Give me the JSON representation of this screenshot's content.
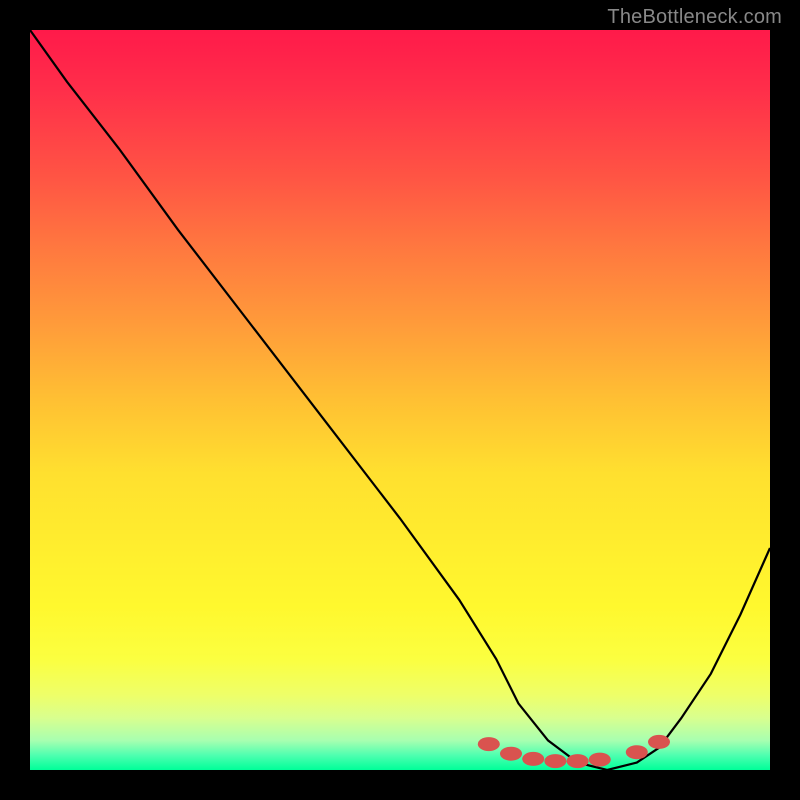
{
  "watermark": "TheBottleneck.com",
  "chart_data": {
    "type": "line",
    "title": "",
    "xlabel": "",
    "ylabel": "",
    "xlim": [
      0,
      100
    ],
    "ylim": [
      0,
      100
    ],
    "series": [
      {
        "name": "bottleneck-curve",
        "x": [
          0,
          5,
          12,
          20,
          30,
          40,
          50,
          58,
          63,
          66,
          70,
          74,
          78,
          82,
          85,
          88,
          92,
          96,
          100
        ],
        "y": [
          100,
          93,
          84,
          73,
          60,
          47,
          34,
          23,
          15,
          9,
          4,
          1,
          0,
          1,
          3,
          7,
          13,
          21,
          30
        ]
      }
    ],
    "markers": {
      "name": "highlight-dots",
      "color": "#d9534f",
      "x": [
        62,
        65,
        68,
        71,
        74,
        77,
        82,
        85
      ],
      "y": [
        3.5,
        2.2,
        1.5,
        1.2,
        1.2,
        1.4,
        2.4,
        3.8
      ]
    },
    "background_gradient": {
      "top": "#ff1a4a",
      "bottom": "#00ff99"
    }
  }
}
